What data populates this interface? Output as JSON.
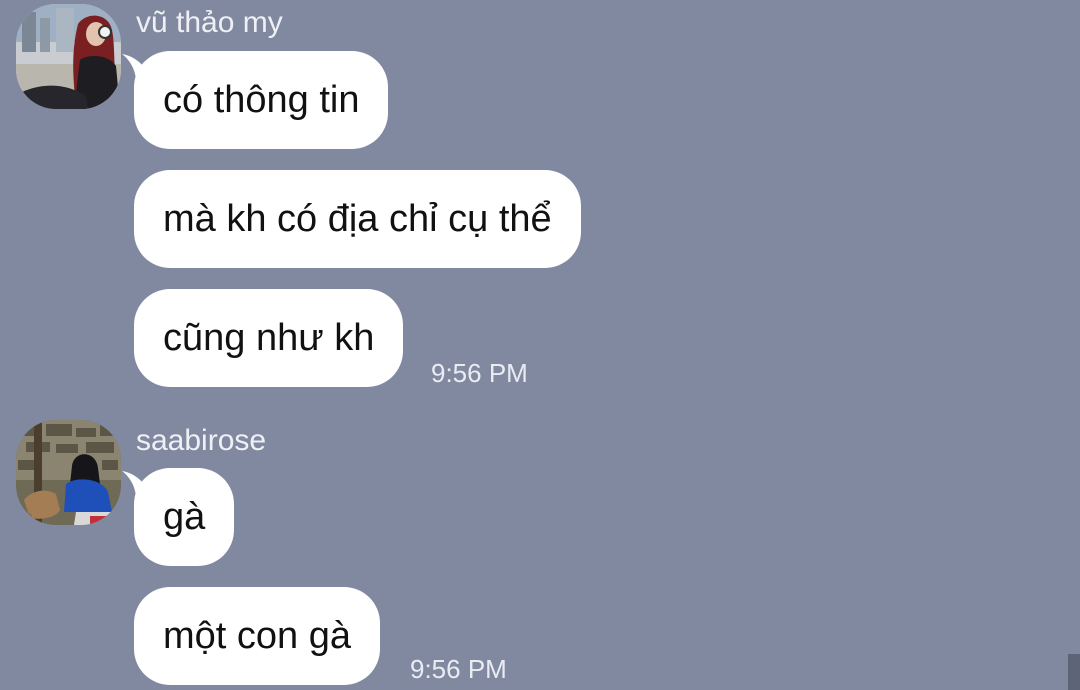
{
  "messages": [
    {
      "sender": "vũ thảo my",
      "avatar": "profile-photo-girl-with-red-hair",
      "bubbles": [
        "có thông tin",
        "mà kh có địa chỉ cụ thể",
        "cũng như kh"
      ],
      "time": "9:56 PM"
    },
    {
      "sender": "saabirose",
      "avatar": "profile-photo-girl-with-deer",
      "bubbles": [
        "gà",
        "một con gà"
      ],
      "time": "9:56 PM"
    }
  ],
  "colors": {
    "background": "#8189a0",
    "bubble": "#ffffff",
    "text": "#111111",
    "meta_text": "#eef0f5"
  }
}
